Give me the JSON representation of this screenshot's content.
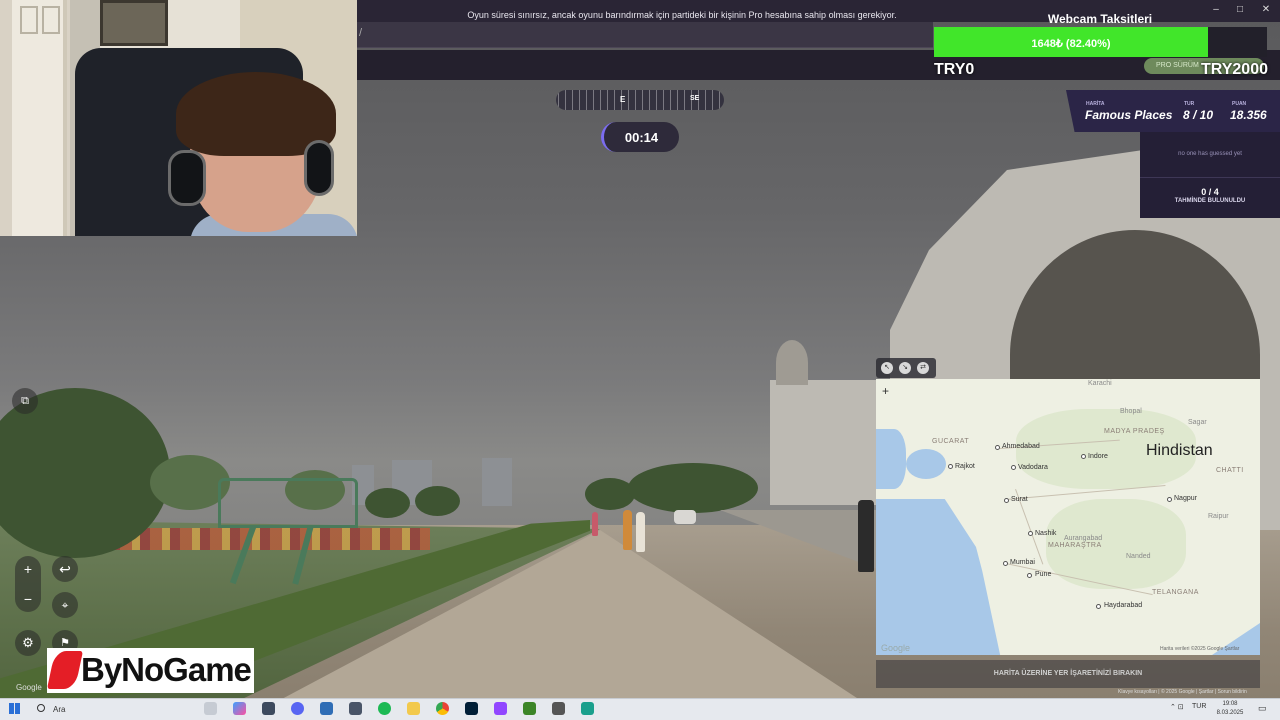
{
  "notice": "Oyun süresi sınırsız, ancak oyunu barındırmak için partideki bir kişinin Pro hesabına sahip olması gerekiyor.",
  "pro_button": "PRO SÜRÜM",
  "donation": {
    "title": "Webcam Taksitleri",
    "progress_label": "1648₺ (82.40%)",
    "progress_fraction": 0.824,
    "left_label": "TRY0",
    "right_label": "TRY2000",
    "fill_color": "#41e62a"
  },
  "compass": {
    "east": "E",
    "southeast": "SE"
  },
  "timer": "00:14",
  "game_info": {
    "map_label": "HARİTA",
    "map_value": "Famous Places",
    "round_label": "TUR",
    "round_value": "8 / 10",
    "score_label": "PUAN",
    "score_value": "18.356"
  },
  "guesses": {
    "none_text": "no one has guessed yet",
    "count": "0 / 4",
    "found_label": "TAHMİNDE BULUNULDU"
  },
  "map": {
    "country": "Hindistan",
    "cities": [
      "Ahmedabad",
      "Rajkot",
      "Vadodara",
      "Indore",
      "Surat",
      "Nagpur",
      "Nashik",
      "Mumbai",
      "Pune",
      "Haydarabad",
      "Bhopal",
      "Aurangabad",
      "Nanded",
      "Raipur",
      "Sagar",
      "Karachi"
    ],
    "states": [
      "GUCARAT",
      "MADYA PRADEŞ",
      "MAHARAŞTRA",
      "TELANGANA",
      "CHATTI"
    ],
    "zoom_in": "+",
    "google": "Google",
    "attribution": "Harita verileri ©2025 Google   Şartlar",
    "cta": "HARİTA ÜZERİNE YER İŞARETİNİZİ BIRAKIN"
  },
  "controls": {
    "zoom_in": "+",
    "zoom_out": "−",
    "back": "↩"
  },
  "bottom_attribution": "Klavye kısayolları  |  © 2025 Google  |  Şartlar  |  Sorun bildirin",
  "logo": {
    "text": "ByNoGame"
  },
  "sv_google": "Google",
  "taskbar": {
    "search": "Ara",
    "tray_lang": "TUR",
    "time": "19:08",
    "date": "8.03.2025"
  },
  "window": {
    "minimize": "–",
    "maximize": "□",
    "close": "✕"
  }
}
